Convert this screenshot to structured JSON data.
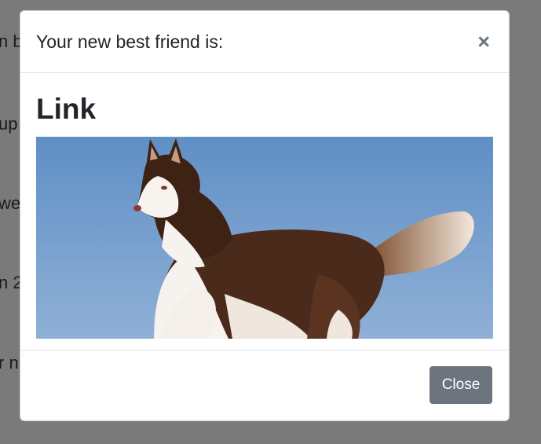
{
  "background": {
    "lines": [
      "n b",
      "up",
      "we",
      "n 2",
      "r n"
    ]
  },
  "modal": {
    "title": "Your new best friend is:",
    "close_icon": "×",
    "dog_name": "Link",
    "image": {
      "subject": "siberian-husky-photo"
    },
    "close_button_label": "Close"
  },
  "colors": {
    "backdrop": "#7a7a7a",
    "close_button_bg": "#6c757d",
    "image_snow": "#6f98c9"
  }
}
